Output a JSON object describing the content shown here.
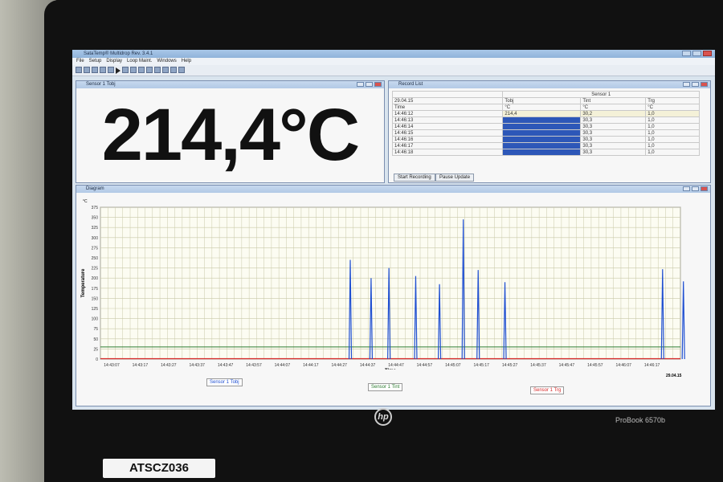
{
  "app": {
    "title": "SataTemp® Multidrop Rev. 3.4.1"
  },
  "menu": [
    "File",
    "Setup",
    "Display",
    "Loop Maint.",
    "Windows",
    "Help"
  ],
  "sensor_panel": {
    "title": "Sensor 1 Tobj",
    "value": "214,4°C"
  },
  "record_list": {
    "title": "Record List",
    "group_header": "Sensor 1",
    "date": "29.04.15",
    "header_row": [
      "Time",
      "°C",
      "°C",
      "°C"
    ],
    "columns": [
      "Tobj",
      "Tint",
      "Trg"
    ],
    "rows": [
      {
        "time": "14:46:12",
        "tobj": "214,4",
        "tint": "30,2",
        "trg": "1,0"
      },
      {
        "time": "14:46:13",
        "tobj": "",
        "tint": "30,3",
        "trg": "1,0"
      },
      {
        "time": "14:46:14",
        "tobj": "",
        "tint": "30,3",
        "trg": "1,0"
      },
      {
        "time": "14:46:15",
        "tobj": "",
        "tint": "30,3",
        "trg": "1,0"
      },
      {
        "time": "14:46:16",
        "tobj": "",
        "tint": "30,3",
        "trg": "1,0"
      },
      {
        "time": "14:46:17",
        "tobj": "",
        "tint": "30,3",
        "trg": "1,0"
      },
      {
        "time": "14:46:18",
        "tobj": "",
        "tint": "30,3",
        "trg": "1,0"
      }
    ],
    "buttons": {
      "start": "Start Recording",
      "pause": "Pause Update"
    }
  },
  "diagram": {
    "title": "Diagram",
    "unit": "°C",
    "date_label": "29.04.15",
    "legend": {
      "tobj": "Sensor 1 Tobj",
      "tint": "Sensor 1 Tint",
      "trg": "Sensor 1 Trg"
    },
    "colors": {
      "tobj": "#1f4fd1",
      "tint": "#2e7d32",
      "trg": "#d62828",
      "grid": "#c9c9a8"
    }
  },
  "chart_data": {
    "type": "line",
    "xlabel": "Time",
    "ylabel": "Temperature",
    "ylim": [
      0,
      375
    ],
    "yticks": [
      0,
      25,
      50,
      75,
      100,
      125,
      150,
      175,
      200,
      225,
      250,
      275,
      300,
      325,
      350,
      375
    ],
    "xticks": [
      "14:43:07",
      "14:43:17",
      "14:43:27",
      "14:43:37",
      "14:43:47",
      "14:43:57",
      "14:44:07",
      "14:44:17",
      "14:44:27",
      "14:44:37",
      "14:44:47",
      "14:44:57",
      "14:45:07",
      "14:45:17",
      "14:45:27",
      "14:45:37",
      "14:45:47",
      "14:45:57",
      "14:46:07",
      "14:46:17"
    ],
    "x_range_seconds": [
      0,
      195
    ],
    "series": [
      {
        "name": "Sensor 1 Tobj",
        "peaks": [
          {
            "t": 84,
            "v": 245
          },
          {
            "t": 91,
            "v": 200
          },
          {
            "t": 97,
            "v": 225
          },
          {
            "t": 106,
            "v": 205
          },
          {
            "t": 114,
            "v": 185
          },
          {
            "t": 122,
            "v": 345
          },
          {
            "t": 127,
            "v": 220
          },
          {
            "t": 136,
            "v": 190
          },
          {
            "t": 189,
            "v": 222
          },
          {
            "t": 196,
            "v": 192
          }
        ]
      },
      {
        "name": "Sensor 1 Tint",
        "values_flat": 30
      },
      {
        "name": "Sensor 1 Trg",
        "values_flat": 1
      }
    ]
  },
  "photo": {
    "brand": "hp",
    "model": "ProBook 6570b",
    "asset_tag": "ATSCZ036"
  }
}
